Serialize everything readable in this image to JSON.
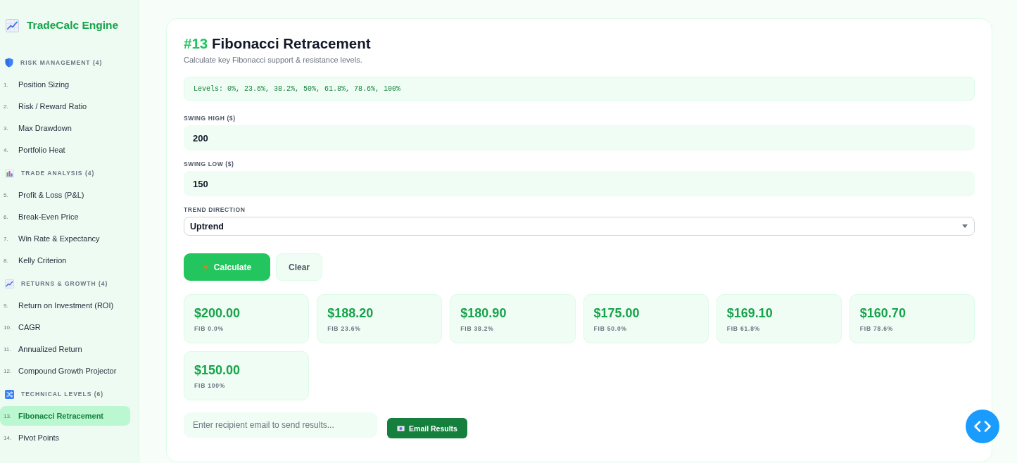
{
  "app": {
    "title": "TradeCalc Engine"
  },
  "sidebar": {
    "sections": [
      {
        "title": "RISK MANAGEMENT (4)",
        "items": [
          {
            "number": "1.",
            "label": "Position Sizing",
            "selected": false
          },
          {
            "number": "2.",
            "label": "Risk / Reward Ratio",
            "selected": false
          },
          {
            "number": "3.",
            "label": "Max Drawdown",
            "selected": false
          },
          {
            "number": "4.",
            "label": "Portfolio Heat",
            "selected": false
          }
        ]
      },
      {
        "title": "TRADE ANALYSIS (4)",
        "items": [
          {
            "number": "5.",
            "label": "Profit & Loss (P&L)",
            "selected": false
          },
          {
            "number": "6.",
            "label": "Break-Even Price",
            "selected": false
          },
          {
            "number": "7.",
            "label": "Win Rate & Expectancy",
            "selected": false
          },
          {
            "number": "8.",
            "label": "Kelly Criterion",
            "selected": false
          }
        ]
      },
      {
        "title": "RETURNS & GROWTH (4)",
        "items": [
          {
            "number": "9.",
            "label": "Return on Investment (ROI)",
            "selected": false
          },
          {
            "number": "10.",
            "label": "CAGR",
            "selected": false
          },
          {
            "number": "11.",
            "label": "Annualized Return",
            "selected": false
          },
          {
            "number": "12.",
            "label": "Compound Growth Projector",
            "selected": false
          }
        ]
      },
      {
        "title": "TECHNICAL LEVELS (6)",
        "items": [
          {
            "number": "13.",
            "label": "Fibonacci Retracement",
            "selected": true
          },
          {
            "number": "14.",
            "label": "Pivot Points",
            "selected": false
          }
        ]
      }
    ]
  },
  "calculator": {
    "number": "#13",
    "title": "Fibonacci Retracement",
    "description": "Calculate key Fibonacci support & resistance levels.",
    "info": "Levels: 0%, 23.6%, 38.2%, 50%, 61.8%, 78.6%, 100%",
    "fields": [
      {
        "kind": "number",
        "label": "SWING HIGH ($)",
        "value": "200"
      },
      {
        "kind": "number",
        "label": "SWING LOW ($)",
        "value": "150"
      },
      {
        "kind": "select",
        "label": "TREND DIRECTION",
        "value": "Uptrend"
      }
    ],
    "buttons": [
      {
        "kind": "primary",
        "label": "Calculate"
      },
      {
        "kind": "secondary",
        "label": "Clear"
      }
    ],
    "results": [
      {
        "value": "$200.00",
        "label": "FIB 0.0%"
      },
      {
        "value": "$188.20",
        "label": "FIB 23.6%"
      },
      {
        "value": "$180.90",
        "label": "FIB 38.2%"
      },
      {
        "value": "$175.00",
        "label": "FIB 50.0%"
      },
      {
        "value": "$169.10",
        "label": "FIB 61.8%"
      },
      {
        "value": "$160.70",
        "label": "FIB 78.6%"
      },
      {
        "value": "$150.00",
        "label": "FIB 100%"
      }
    ],
    "email": {
      "placeholder": "Enter recipient email to send results...",
      "button": "Email Results"
    }
  }
}
